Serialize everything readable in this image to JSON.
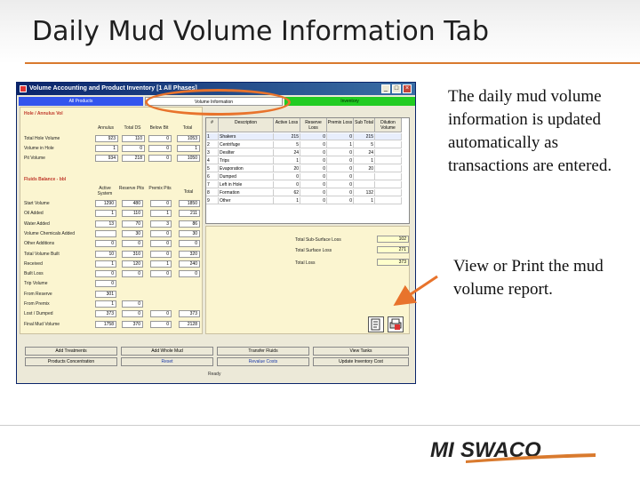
{
  "slide": {
    "title": "Daily Mud Volume Information Tab",
    "text_a": "The daily mud volume information is updated automatically as transactions are entered.",
    "text_b": "View or Print the mud volume report.",
    "accent_color": "#d97a2e",
    "logo_text": "MI SWACO"
  },
  "window": {
    "title": "Volume Accounting and Product Inventory [1 All Phases]",
    "buttons": [
      "_",
      "□",
      "×"
    ],
    "tabs": [
      "All Products",
      "Volume Information",
      "Inventory"
    ]
  },
  "left_panel": {
    "section1": "Hole / Annulus Vol",
    "section1_cols": [
      "Annulus",
      "Total DS",
      "Below Bit",
      "Total"
    ],
    "section1_rows": [
      {
        "label": "Total Hole Volume",
        "values": [
          "923",
          "110",
          "0",
          "1053"
        ]
      },
      {
        "label": "Volume in Hole",
        "values": [
          "1",
          "0",
          "0",
          "1"
        ]
      },
      {
        "label": "Pit Volume",
        "values": [
          "934",
          "218",
          "0",
          "1050"
        ]
      }
    ],
    "section2": "Fluids Balance - bbl",
    "section2_cols": [
      "Active System",
      "Reserve Pits",
      "Premix Pits",
      "Total"
    ],
    "section2_rows": [
      {
        "label": "Start Volume",
        "values": [
          "1290",
          "480",
          "0",
          "1850"
        ]
      },
      {
        "label": "Oil Added",
        "values": [
          "1",
          "110",
          "1",
          "211"
        ]
      },
      {
        "label": "Water Added",
        "values": [
          "13",
          "70",
          "3",
          "86"
        ]
      },
      {
        "label": "Volume Chemicals Added",
        "values": [
          "",
          "30",
          "0",
          "30"
        ]
      },
      {
        "label": "Other Additions",
        "values": [
          "0",
          "0",
          "0",
          "0"
        ]
      },
      {
        "label": "Total Volume Built",
        "values": [
          "10",
          "310",
          "0",
          "320"
        ]
      },
      {
        "label": "Received",
        "values": [
          "1",
          "120",
          "1",
          "240"
        ]
      },
      {
        "label": "Built Loss",
        "values": [
          "0",
          "0",
          "0",
          "0"
        ]
      },
      {
        "label": "Trip Volume",
        "values": [
          "0",
          "",
          "",
          ""
        ]
      },
      {
        "label": "From Reserve",
        "values": [
          "301",
          "",
          "",
          ""
        ]
      },
      {
        "label": "From Premix",
        "values": [
          "1",
          "0",
          "",
          ""
        ]
      },
      {
        "label": "Lost / Dumped",
        "values": [
          "373",
          "0",
          "0",
          "373"
        ]
      },
      {
        "label": "Final Mud Volume",
        "values": [
          "1758",
          "370",
          "0",
          "2128"
        ]
      }
    ]
  },
  "grid": {
    "columns": [
      "#",
      "Description",
      "Active Loss",
      "Reserve Loss",
      "Premix Loss",
      "Sub Total",
      "Dilution Volume"
    ],
    "rows": [
      [
        "1",
        "Shakers",
        "215",
        "0",
        "0",
        "215",
        ""
      ],
      [
        "2",
        "Centrifuge",
        "5",
        "0",
        "1",
        "5",
        ""
      ],
      [
        "3",
        "Desilter",
        "24",
        "0",
        "0",
        "24",
        ""
      ],
      [
        "4",
        "Trips",
        "1",
        "0",
        "0",
        "1",
        ""
      ],
      [
        "5",
        "Evaporation",
        "20",
        "0",
        "0",
        "20",
        ""
      ],
      [
        "6",
        "Dumped",
        "0",
        "0",
        "0",
        "",
        ""
      ],
      [
        "7",
        "Left in Hole",
        "0",
        "0",
        "0",
        "",
        ""
      ],
      [
        "8",
        "Formation",
        "62",
        "0",
        "0",
        "132",
        ""
      ],
      [
        "9",
        "Other",
        "1",
        "0",
        "0",
        "1",
        ""
      ]
    ]
  },
  "totals": {
    "sub_surface_label": "Total Sub-Surface Loss",
    "sub_surface_value": "102",
    "surface_label": "Total Surface Loss",
    "surface_value": "271",
    "total_label": "Total Loss",
    "total_value": "373"
  },
  "bottom_buttons": {
    "row1": [
      "Add Treatments",
      "Add Whole Mud",
      "Transfer Fluids",
      "View Tanks"
    ],
    "row2": [
      "Products Concentration",
      "Reset",
      "Revalue Costs",
      "Update Inventory Cost"
    ],
    "footer": "Ready"
  }
}
